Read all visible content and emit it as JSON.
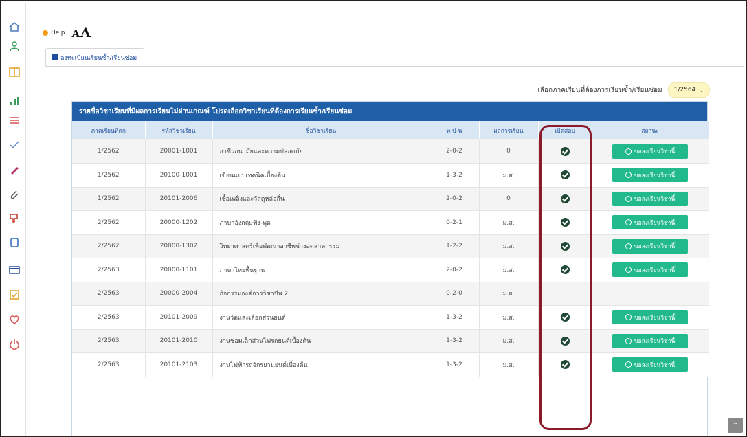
{
  "header": {
    "help_label": "Help",
    "font_size_small": "A",
    "font_size_large": "A"
  },
  "tab": {
    "label": "ลงทะเบียนเรียนซ้ำ/เรียนซ่อม"
  },
  "term_selector": {
    "label": "เลือกภาคเรียนที่ต้องการเรียนซ้ำ/เรียนซ่อม",
    "value": "1/2564"
  },
  "panel": {
    "title": "รายชื่อวิชาเรียนที่มีผลการเรียนไม่ผ่านเกณฑ์ โปรดเลือกวิชาเรียนที่ต้องการเรียนซ้ำ/เรียนซ่อม"
  },
  "table": {
    "columns": [
      "ภาคเรียนที่ตก",
      "รหัสวิชาเรียน",
      "ชื่อวิชาเรียน",
      "ท-ป-น",
      "ผลการเรียน",
      "เปิดสอบ",
      "สถานะ"
    ],
    "button_label": "ขอลงเรียนวิชานี้",
    "rows": [
      {
        "term": "1/2562",
        "code": "20001-1001",
        "name": "อาชีวอนามัยและความปลอดภัย",
        "tpn": "2-0-2",
        "grade": "0",
        "open": true,
        "action": true
      },
      {
        "term": "1/2562",
        "code": "20100-1001",
        "name": "เขียนแบบเทคนิคเบื้องต้น",
        "tpn": "1-3-2",
        "grade": "ม.ส.",
        "open": true,
        "action": true
      },
      {
        "term": "1/2562",
        "code": "20101-2006",
        "name": "เชื้อเพลิงและวัสดุหล่อลื่น",
        "tpn": "2-0-2",
        "grade": "0",
        "open": true,
        "action": true
      },
      {
        "term": "2/2562",
        "code": "20000-1202",
        "name": "ภาษาอังกฤษฟัง-พูด",
        "tpn": "0-2-1",
        "grade": "ม.ส.",
        "open": true,
        "action": true
      },
      {
        "term": "2/2562",
        "code": "20000-1302",
        "name": "วิทยาศาสตร์เพื่อพัฒนาอาชีพช่างอุตสาหกรรม",
        "tpn": "1-2-2",
        "grade": "ม.ส.",
        "open": true,
        "action": true
      },
      {
        "term": "2/2563",
        "code": "20000-1101",
        "name": "ภาษาไทยพื้นฐาน",
        "tpn": "2-0-2",
        "grade": "ม.ส.",
        "open": true,
        "action": true
      },
      {
        "term": "2/2563",
        "code": "20000-2004",
        "name": "กิจกรรมองค์การวิชาชีพ 2",
        "tpn": "0-2-0",
        "grade": "ม.ผ.",
        "open": false,
        "action": false
      },
      {
        "term": "2/2563",
        "code": "20101-2009",
        "name": "งานวัดและเลือกส่วนยนต์",
        "tpn": "1-3-2",
        "grade": "ม.ส.",
        "open": true,
        "action": true
      },
      {
        "term": "2/2563",
        "code": "20101-2010",
        "name": "งานซ่อมเล็กส่วนไฟรถยนต์เบื้องต้น",
        "tpn": "1-3-2",
        "grade": "ม.ส.",
        "open": true,
        "action": true
      },
      {
        "term": "2/2563",
        "code": "20101-2103",
        "name": "งานไฟฟ้ารถจักรยานยนต์เบื้องต้น",
        "tpn": "1-3-2",
        "grade": "ม.ส.",
        "open": true,
        "action": true
      }
    ]
  },
  "sidebar_icons": [
    "home-icon",
    "user-icon",
    "book-icon",
    "chart-icon",
    "list-icon",
    "check-icon",
    "pencil-icon",
    "paperclip-icon",
    "tag-icon",
    "copy-icon",
    "card-icon",
    "checkbox-icon",
    "heart-icon",
    "power-icon"
  ],
  "colors": {
    "header_blue": "#1f5fa8",
    "button_green": "#22b98c",
    "highlight": "#8b1a2b",
    "check_green": "#1e4a33"
  }
}
